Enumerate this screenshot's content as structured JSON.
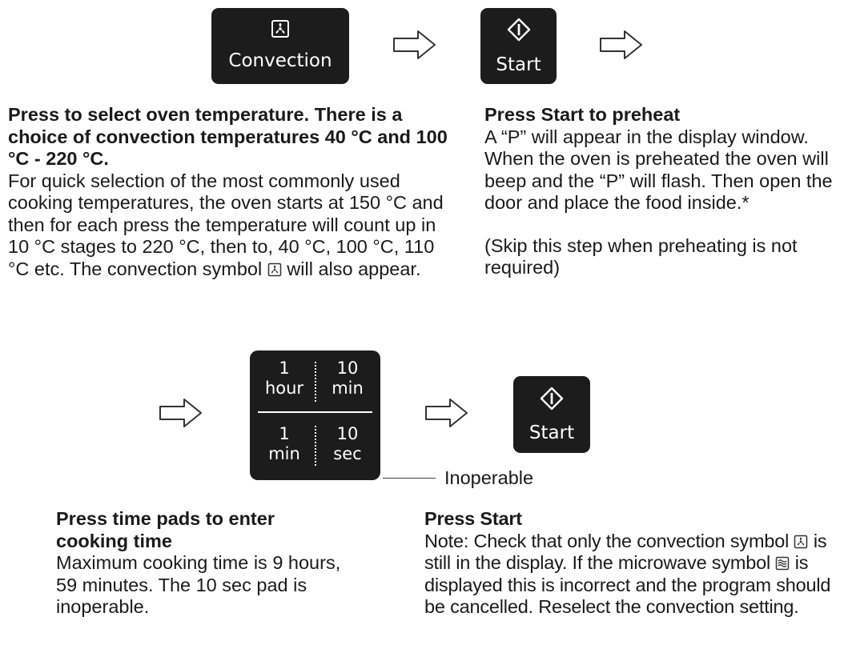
{
  "pads": {
    "convection_label": "Convection",
    "start_label": "Start",
    "start2_label": "Start",
    "time": {
      "top_left_value": "1",
      "top_left_unit": "hour",
      "top_right_value": "10",
      "top_right_unit": "min",
      "bottom_left_value": "1",
      "bottom_left_unit": "min",
      "bottom_right_value": "10",
      "bottom_right_unit": "sec"
    }
  },
  "callout": {
    "inoperable": "Inoperable"
  },
  "step1": {
    "heading": "Press to select oven temperature. There is a choice of convection temperatures 40 °C and 100 °C - 220 °C.",
    "body_before_symbol": "For quick selection of the most commonly used cooking temperatures, the oven starts at 150 °C and then for each press the temperature will count up in 10 °C stages to 220 °C, then to, 40 °C, 100 °C, 110 °C etc. The convection symbol",
    "body_after_symbol": "will also appear."
  },
  "step2": {
    "heading": "Press Start to preheat",
    "body": "A “P” will appear in the display window. When the oven is preheated the oven will beep and the “P” will flash. Then open the door and place the food inside.*",
    "note": "(Skip this step when preheating is not required)"
  },
  "step3": {
    "heading": "Press time pads to enter cooking time",
    "body": "Maximum cooking time is 9 hours, 59 minutes. The 10 sec pad is inoperable."
  },
  "step4": {
    "heading": "Press Start",
    "body_part1": "Note: Check that only the convection symbol",
    "body_part2": "is still in the display. If the microwave symbol",
    "body_part3": "is displayed this is incorrect and the program should be cancelled. Reselect the convection setting."
  }
}
